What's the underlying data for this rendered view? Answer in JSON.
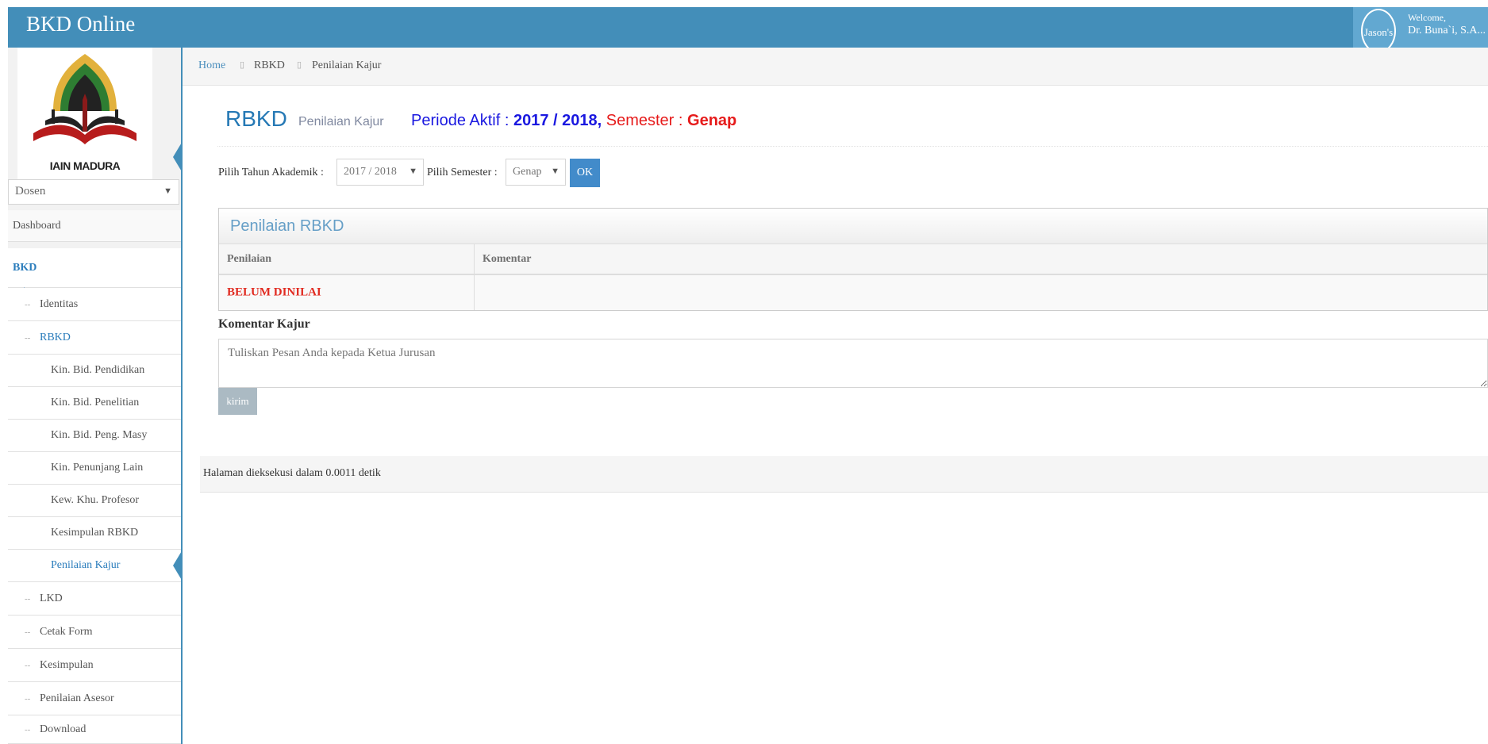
{
  "app": {
    "brand": "BKD Online"
  },
  "user": {
    "avatar_label": "Jason's",
    "welcome": "Welcome,",
    "name": "Dr. Buna`i, S.A..."
  },
  "logo": {
    "text": "IAIN MADURA"
  },
  "role_select": {
    "value": "Dosen"
  },
  "nav": {
    "dashboard": "Dashboard",
    "bkd": "BKD",
    "identitas": "Identitas",
    "rbkd": "RBKD",
    "rbkd_children": [
      "Kin. Bid. Pendidikan",
      "Kin. Bid. Penelitian",
      "Kin. Bid. Peng. Masy",
      "Kin. Penunjang Lain",
      "Kew. Khu. Profesor",
      "Kesimpulan RBKD",
      "Penilaian Kajur"
    ],
    "lkd": "LKD",
    "cetak_form": "Cetak Form",
    "kesimpulan": "Kesimpulan",
    "penilaian_asesor": "Penilaian Asesor",
    "download": "Download"
  },
  "breadcrumb": {
    "home": "Home",
    "level1": "RBKD",
    "level2": "Penilaian Kajur"
  },
  "page_header": {
    "title": "RBKD",
    "subtitle": "Penilaian Kajur",
    "periode_label": "Periode Aktif :",
    "periode_value": "2017 / 2018,",
    "semester_label": "Semester :",
    "semester_value": "Genap"
  },
  "filter": {
    "tahun_label": "Pilih Tahun Akademik :",
    "tahun_value": "2017 / 2018",
    "semester_label": "Pilih Semester :",
    "semester_value": "Genap",
    "ok_label": "OK"
  },
  "widget": {
    "title": "Penilaian RBKD",
    "columns": [
      "Penilaian",
      "Komentar"
    ],
    "row": {
      "penilaian": "BELUM DINILAI",
      "komentar": ""
    }
  },
  "komentar": {
    "label": "Komentar Kajur",
    "placeholder": "Tuliskan Pesan Anda kepada Ketua Jurusan",
    "submit_label": "kirim"
  },
  "footer": {
    "text": "Halaman dieksekusi dalam 0.0011 detik"
  },
  "colors": {
    "primary": "#438eb9",
    "accent_red": "#e12b21",
    "periode_blue": "#1a18e0"
  }
}
